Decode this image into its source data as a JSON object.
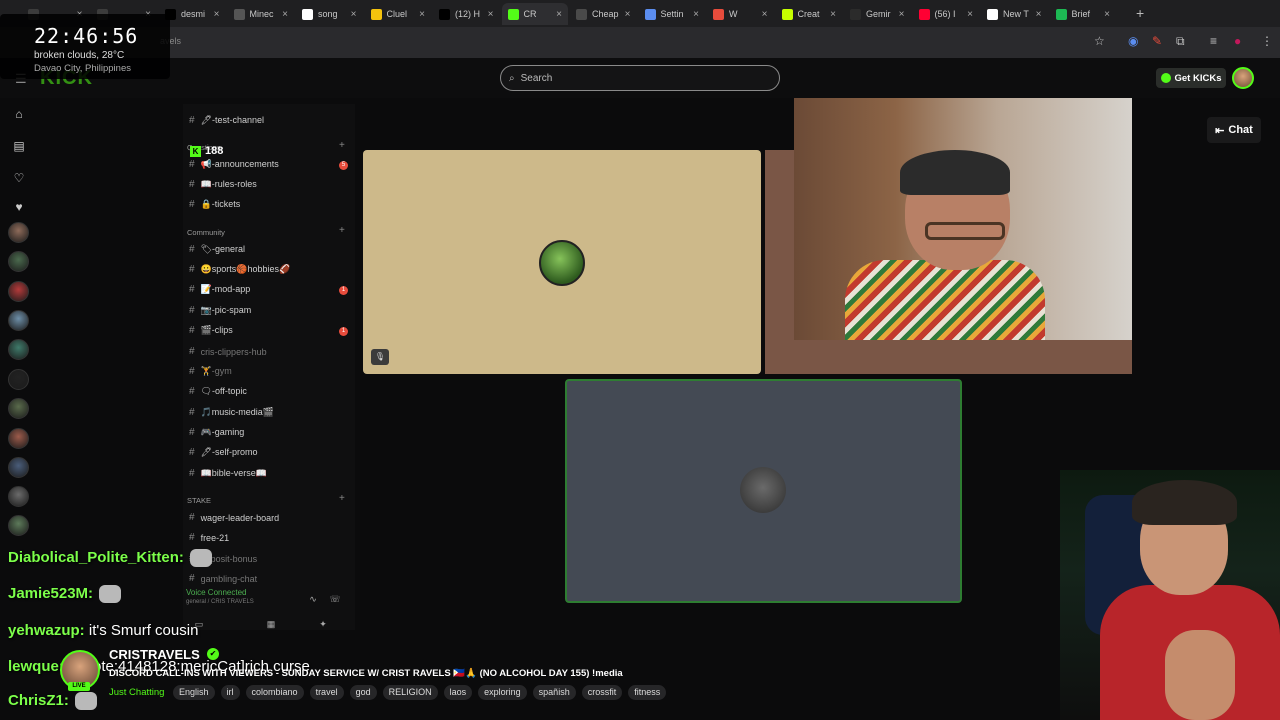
{
  "browser": {
    "tabs": [
      {
        "label": "",
        "icon": "generic-icon",
        "color": "#3c3c3c"
      },
      {
        "label": "",
        "icon": "generic-icon",
        "color": "#3c3c3c"
      },
      {
        "label": "desmi",
        "icon": "x-icon",
        "color": "#000000"
      },
      {
        "label": "Minec",
        "icon": "globe-icon",
        "color": "#555555"
      },
      {
        "label": "song",
        "icon": "google-icon",
        "color": "#ffffff"
      },
      {
        "label": "Cluel",
        "icon": "chevron-icon",
        "color": "#f4c20d"
      },
      {
        "label": "(12) H",
        "icon": "x-icon",
        "color": "#000000"
      },
      {
        "label": "CR",
        "icon": "kick-icon",
        "color": "#53fc18",
        "active": true
      },
      {
        "label": "Cheap",
        "icon": "generic-icon",
        "color": "#4a4a4a"
      },
      {
        "label": "Settin",
        "icon": "gear-icon",
        "color": "#5b8def"
      },
      {
        "label": "W",
        "icon": "wiki-icon",
        "color": "#e74c3c"
      },
      {
        "label": "Creat",
        "icon": "creator-icon",
        "color": "#c6ff00"
      },
      {
        "label": "Gemir",
        "icon": "gemini-icon",
        "color": "#2b2b2b"
      },
      {
        "label": "(56) I",
        "icon": "youtube-icon",
        "color": "#ff0033"
      },
      {
        "label": "New T",
        "icon": "chrome-icon",
        "color": "#ffffff"
      },
      {
        "label": "Brief",
        "icon": "brief-icon",
        "color": "#1db954"
      }
    ],
    "new_tab": "+",
    "url": "avels"
  },
  "clock": {
    "time": "22:46:56",
    "weather": "broken clouds, 28°C",
    "location": "Davao City, Philippines"
  },
  "header": {
    "logo": "KICK",
    "search_placeholder": "Search",
    "get_kicks": "Get KICKs"
  },
  "discord": {
    "viewer_count": "188",
    "channels": [
      {
        "name": "🖊-test-channel"
      },
      {
        "name": "📢-announcements",
        "badge": "5"
      },
      {
        "name": "📖-rules-roles"
      },
      {
        "name": "🔒-tickets"
      },
      {
        "name": "🏷-general"
      },
      {
        "name": "😀sports🏀hobbies🏈"
      },
      {
        "name": "📝-mod-app",
        "badge": "1"
      },
      {
        "name": "📷-pic-spam"
      },
      {
        "name": "🎬-clips",
        "badge": "1"
      },
      {
        "name": "cris-clippers-hub",
        "dim": true
      },
      {
        "name": "🏋-gym",
        "dim": true
      },
      {
        "name": "🗨-off-topic"
      },
      {
        "name": "🎵music-media🎬"
      },
      {
        "name": "🎮-gaming"
      },
      {
        "name": "🖊-self-promo"
      },
      {
        "name": "📖bible-verse📖"
      },
      {
        "name": "wager-leader-board"
      },
      {
        "name": "free-21"
      },
      {
        "name": "deposit-bonus",
        "dim": true
      },
      {
        "name": "gambling-chat",
        "dim": true
      }
    ],
    "categories": [
      "Questions",
      "Community",
      "STAKE"
    ],
    "voice_status": "Voice Connected",
    "voice_sub": "general / CRIS TRAVELS"
  },
  "chat_button": "Chat",
  "chat": [
    {
      "user": "Diabolical_Polite_Kitten:",
      "text": "",
      "color": "#7cff4a",
      "emote": true
    },
    {
      "user": "Jamie523M:",
      "text": "",
      "color": "#7cff4a",
      "emote": true
    },
    {
      "user": "yehwazup:",
      "text": " it's Smurf cousin",
      "color": "#7cff4a"
    },
    {
      "user": "lewque:",
      "text": " [emote:4148128:mericCat]rich curse",
      "color": "#7cff4a"
    },
    {
      "user": "ChrisZ1:",
      "text": "",
      "color": "#7cff4a",
      "emote": true
    }
  ],
  "stream": {
    "name": "CRISTRAVELS",
    "live": "LIVE",
    "title": "DISCORD CALL-INS WITH VIEWERS - SUNDAY SERVICE W/ CRIST RAVELS 🇵🇭🙏 (NO ALCOHOL DAY 155) !media",
    "category": "Just Chatting",
    "tags": [
      "English",
      "irl",
      "colombiano",
      "travel",
      "god",
      "RELIGION",
      "laos",
      "exploring",
      "spañish",
      "crossfit",
      "fitness"
    ]
  },
  "colors": {
    "accent": "#53fc18",
    "badge": "#e74c3c",
    "tile_active_border": "#2e7d32"
  }
}
